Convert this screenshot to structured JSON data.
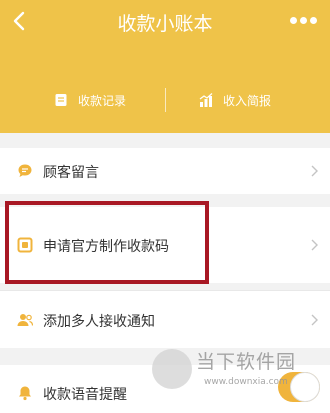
{
  "nav": {
    "title": "收款小账本"
  },
  "quick_actions": [
    {
      "label": "收款记录",
      "icon": "document-icon"
    },
    {
      "label": "收入简报",
      "icon": "bar-chart-icon"
    }
  ],
  "rows": [
    {
      "label": "顾客留言",
      "icon": "chat-bubble-icon"
    },
    {
      "label": "申请官方制作收款码",
      "icon": "qr-frame-icon"
    },
    {
      "label": "添加多人接收通知",
      "icon": "people-icon"
    },
    {
      "label": "收款语音提醒",
      "icon": "bell-icon",
      "toggle_on": true
    }
  ],
  "watermark": {
    "text": "当下软件园",
    "url": "www.downxia.com"
  },
  "colors": {
    "header": "#efc349",
    "accent": "#f0b43c",
    "highlight": "#a81824"
  }
}
